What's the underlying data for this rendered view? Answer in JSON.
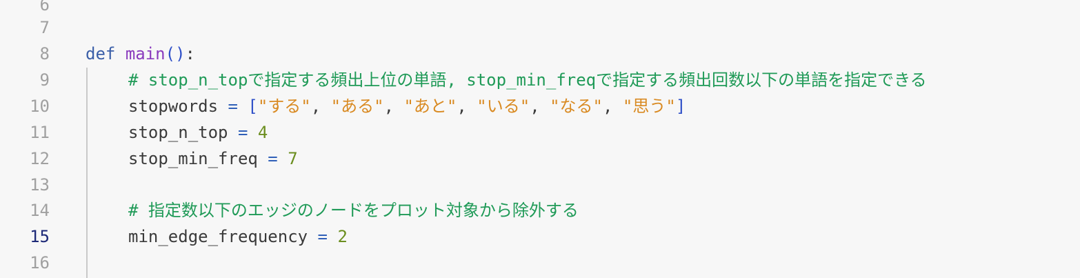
{
  "editor": {
    "lines": [
      {
        "num": "6"
      },
      {
        "num": "7"
      },
      {
        "num": "8",
        "kw": "def",
        "fn": "main",
        "open_paren": "(",
        "close_paren": ")",
        "colon": ":"
      },
      {
        "num": "9",
        "comment": "# stop_n_topで指定する頻出上位の単語, stop_min_freqで指定する頻出回数以下の単語を指定できる"
      },
      {
        "num": "10",
        "var": "stopwords",
        "op": "=",
        "open_bracket": "[",
        "strings": [
          "\"する\"",
          "\"ある\"",
          "\"あと\"",
          "\"いる\"",
          "\"なる\"",
          "\"思う\""
        ],
        "sep": ", ",
        "close_bracket": "]"
      },
      {
        "num": "11",
        "var": "stop_n_top",
        "op": "=",
        "value": "4"
      },
      {
        "num": "12",
        "var": "stop_min_freq",
        "op": "=",
        "value": "7"
      },
      {
        "num": "13"
      },
      {
        "num": "14",
        "comment": "# 指定数以下のエッジのノードをプロット対象から除外する"
      },
      {
        "num": "15",
        "var": "min_edge_frequency",
        "op": "=",
        "value": "2"
      },
      {
        "num": "16"
      }
    ]
  },
  "colors": {
    "background": "#f7f7f7",
    "line_number": "#a0a0a0",
    "line_number_active": "#1e2a78",
    "keyword": "#3b5fa8",
    "function": "#8a3bbd",
    "comment": "#1f9a57",
    "string": "#d98a22",
    "number": "#6b8e1f",
    "operator": "#2f5fb8"
  }
}
